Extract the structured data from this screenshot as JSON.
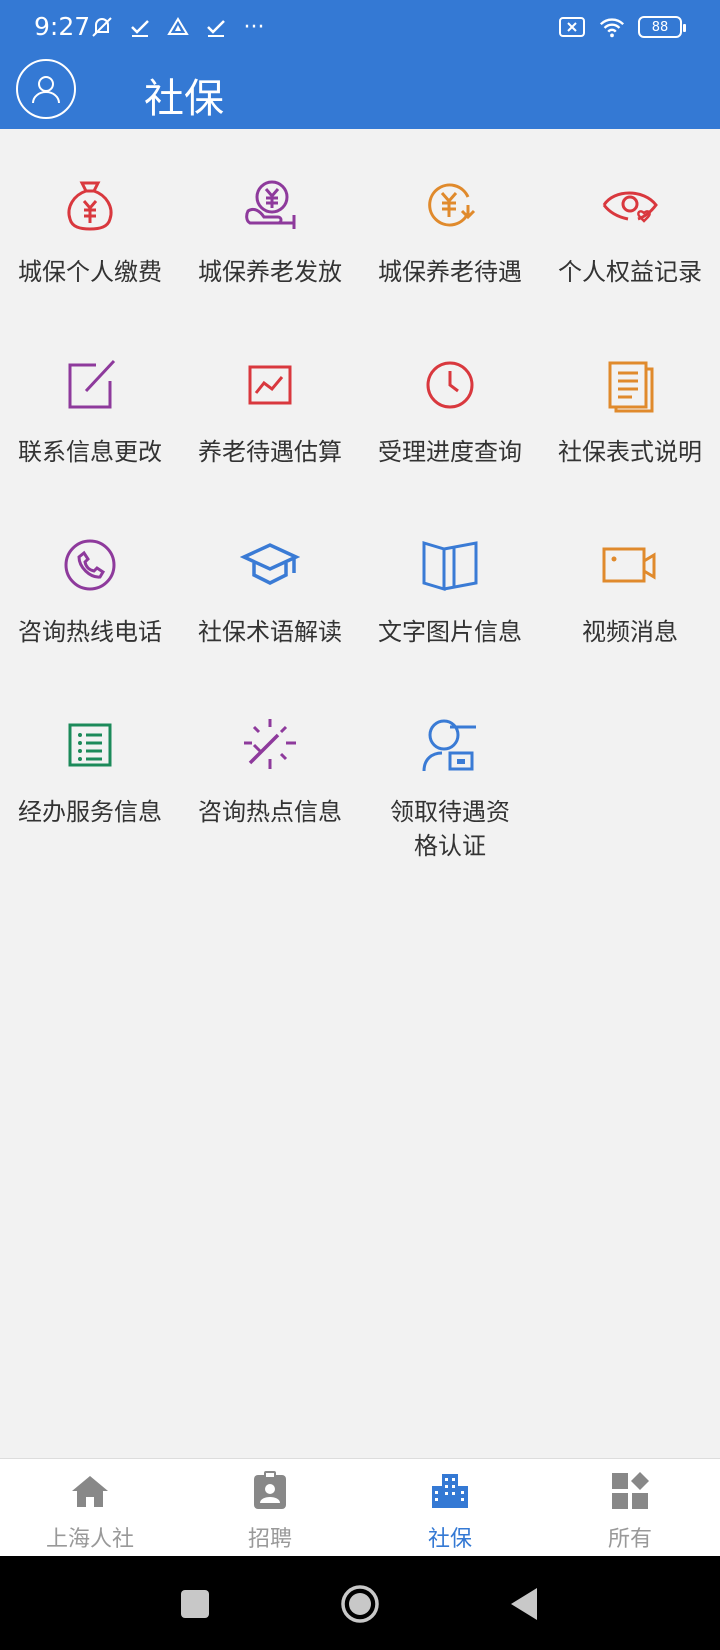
{
  "status": {
    "time": "9:27",
    "battery": "88"
  },
  "header": {
    "title": "社保"
  },
  "colors": {
    "primary": "#3479d4",
    "red": "#d9383e",
    "purple": "#8e3a9c",
    "orange": "#e08a2c",
    "blue": "#3a7bd5",
    "green": "#1c8a5a"
  },
  "tiles": [
    {
      "label": "城保个人缴费",
      "icon": "money-bag-icon"
    },
    {
      "label": "城保养老发放",
      "icon": "hand-yuan-icon"
    },
    {
      "label": "城保养老待遇",
      "icon": "yuan-cycle-icon"
    },
    {
      "label": "个人权益记录",
      "icon": "eye-heart-icon"
    },
    {
      "label": "联系信息更改",
      "icon": "edit-icon"
    },
    {
      "label": "养老待遇估算",
      "icon": "chart-icon"
    },
    {
      "label": "受理进度查询",
      "icon": "clock-icon"
    },
    {
      "label": "社保表式说明",
      "icon": "document-icon"
    },
    {
      "label": "咨询热线电话",
      "icon": "phone-icon"
    },
    {
      "label": "社保术语解读",
      "icon": "graduation-cap-icon"
    },
    {
      "label": "文字图片信息",
      "icon": "book-icon"
    },
    {
      "label": "视频消息",
      "icon": "video-camera-icon"
    },
    {
      "label": "经办服务信息",
      "icon": "list-icon"
    },
    {
      "label": "咨询热点信息",
      "icon": "magic-wand-icon"
    },
    {
      "label": "领取待遇资格认证",
      "icon": "user-id-icon"
    }
  ],
  "bottom_nav": [
    {
      "label": "上海人社",
      "icon": "home-icon",
      "active": false
    },
    {
      "label": "招聘",
      "icon": "badge-icon",
      "active": false
    },
    {
      "label": "社保",
      "icon": "buildings-icon",
      "active": true
    },
    {
      "label": "所有",
      "icon": "apps-icon",
      "active": false
    }
  ]
}
